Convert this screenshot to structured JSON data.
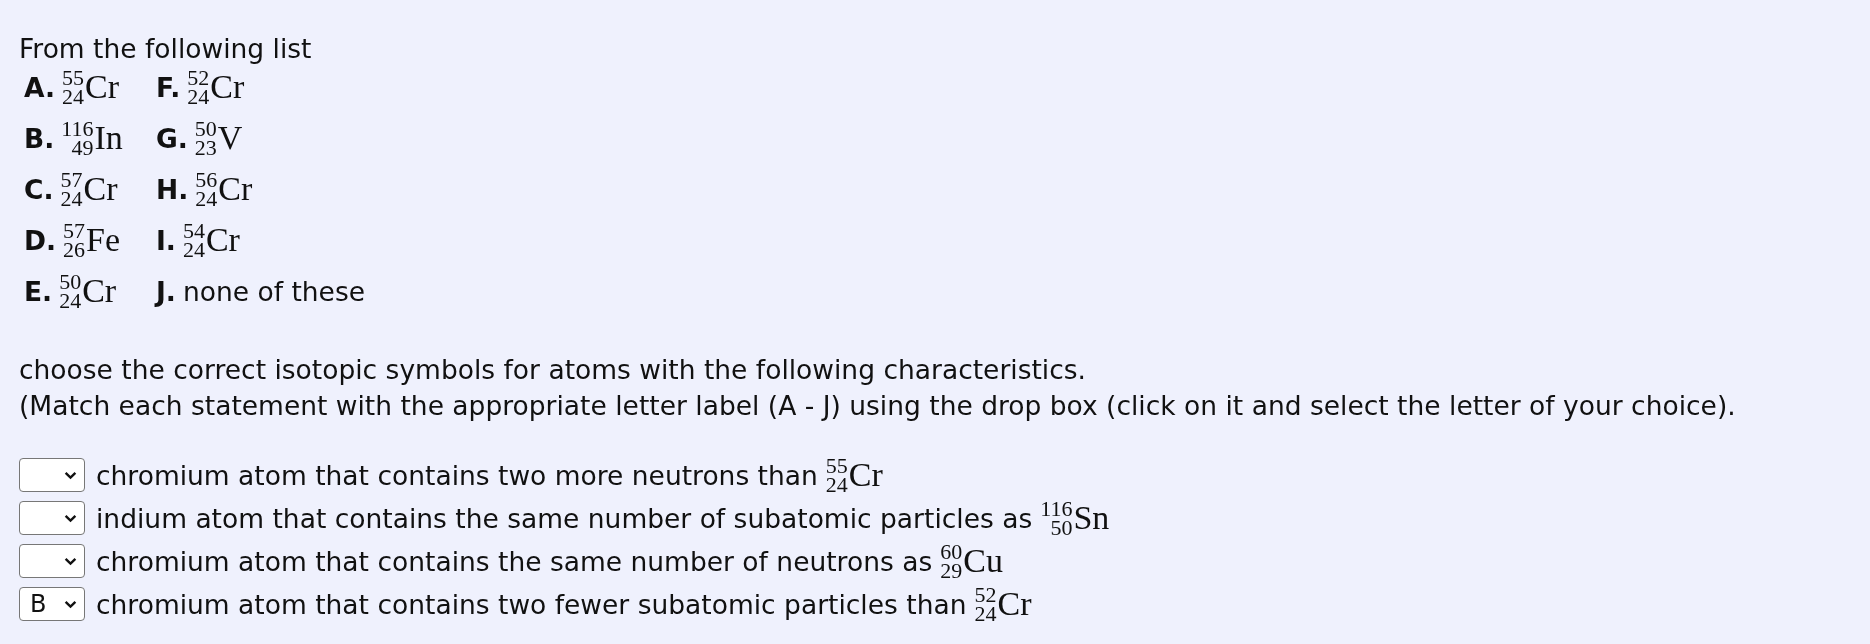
{
  "intro": "From the following list",
  "options": [
    {
      "kind": "isotope",
      "letter": "A.",
      "mass": "55",
      "atomic": "24",
      "symbol": "Cr"
    },
    {
      "kind": "isotope",
      "letter": "F.",
      "mass": "52",
      "atomic": "24",
      "symbol": "Cr"
    },
    {
      "kind": "isotope",
      "letter": "B.",
      "mass": "116",
      "atomic": "49",
      "symbol": "In"
    },
    {
      "kind": "isotope",
      "letter": "G.",
      "mass": "50",
      "atomic": "23",
      "symbol": "V"
    },
    {
      "kind": "isotope",
      "letter": "C.",
      "mass": "57",
      "atomic": "24",
      "symbol": "Cr"
    },
    {
      "kind": "isotope",
      "letter": "H.",
      "mass": "56",
      "atomic": "24",
      "symbol": "Cr"
    },
    {
      "kind": "isotope",
      "letter": "D.",
      "mass": "57",
      "atomic": "26",
      "symbol": "Fe"
    },
    {
      "kind": "isotope",
      "letter": "I.",
      "mass": "54",
      "atomic": "24",
      "symbol": "Cr"
    },
    {
      "kind": "isotope",
      "letter": "E.",
      "mass": "50",
      "atomic": "24",
      "symbol": "Cr"
    },
    {
      "kind": "text",
      "letter": "J.",
      "text": "none of these"
    }
  ],
  "instructions": [
    "choose the correct isotopic symbols for atoms with the following characteristics.",
    "(Match each statement with the appropriate letter label (A - J) using the drop box (click on it and select the letter of your choice)."
  ],
  "statements": [
    {
      "text": "chromium atom that contains two more neutrons than",
      "mass": "55",
      "atomic": "24",
      "symbol": "Cr"
    },
    {
      "text": "indium atom that contains the same number of subatomic particles as",
      "mass": "116",
      "atomic": "50",
      "symbol": "Sn"
    },
    {
      "text": "chromium atom that contains the same number of neutrons as",
      "mass": "60",
      "atomic": "29",
      "symbol": "Cu"
    },
    {
      "value": "B",
      "text": "chromium atom that contains two fewer subatomic particles than",
      "mass": "52",
      "atomic": "24",
      "symbol": "Cr"
    }
  ]
}
